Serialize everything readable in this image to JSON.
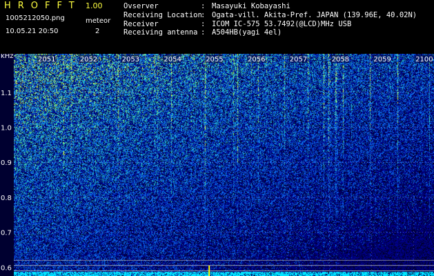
{
  "header": {
    "app_title": "HROFFT",
    "app_version": "1.00",
    "file_name": "1005212050.png",
    "date_time": "10.05.21 20:50",
    "meteor_label": "meteor",
    "meteor_count": "2"
  },
  "station_info": [
    {
      "label": "Ovserver",
      "colon": ":",
      "value": "Masayuki Kobayashi"
    },
    {
      "label": "Receiving Location",
      "colon": ":",
      "value": "Ogata-vill. Akita-Pref. JAPAN (139.96E, 40.02N)"
    },
    {
      "label": "Receiver",
      "colon": ":",
      "value": "ICOM IC-575 53.7492(@LCD)MHz USB"
    },
    {
      "label": "Receiving antenna",
      "colon": ":",
      "value": "A504HB(yagi 4el)"
    }
  ],
  "chart_data": {
    "type": "heatmap",
    "ylabel": "kHz",
    "x_ticks": [
      "2051",
      "2052",
      "2053",
      "2054",
      "2055",
      "2056",
      "2057",
      "2058",
      "2059",
      "2100"
    ],
    "y_ticks": [
      "1.1",
      "1.0",
      "0.9",
      "0.8",
      "0.7",
      "0.6"
    ],
    "y_values": [
      1.1,
      1.0,
      0.9,
      0.8,
      0.7,
      0.6
    ],
    "ylim": [
      0.575,
      1.21
    ],
    "grid": true,
    "colors": {
      "background": "#000040",
      "low": "#0000a0",
      "mid": "#2060ff",
      "high": "#30ffb0",
      "peak": "#ffff00",
      "baseline": "#00ffff"
    },
    "meteor_echoes": [
      {
        "time": "2055",
        "freq_khz": 0.585
      }
    ]
  }
}
